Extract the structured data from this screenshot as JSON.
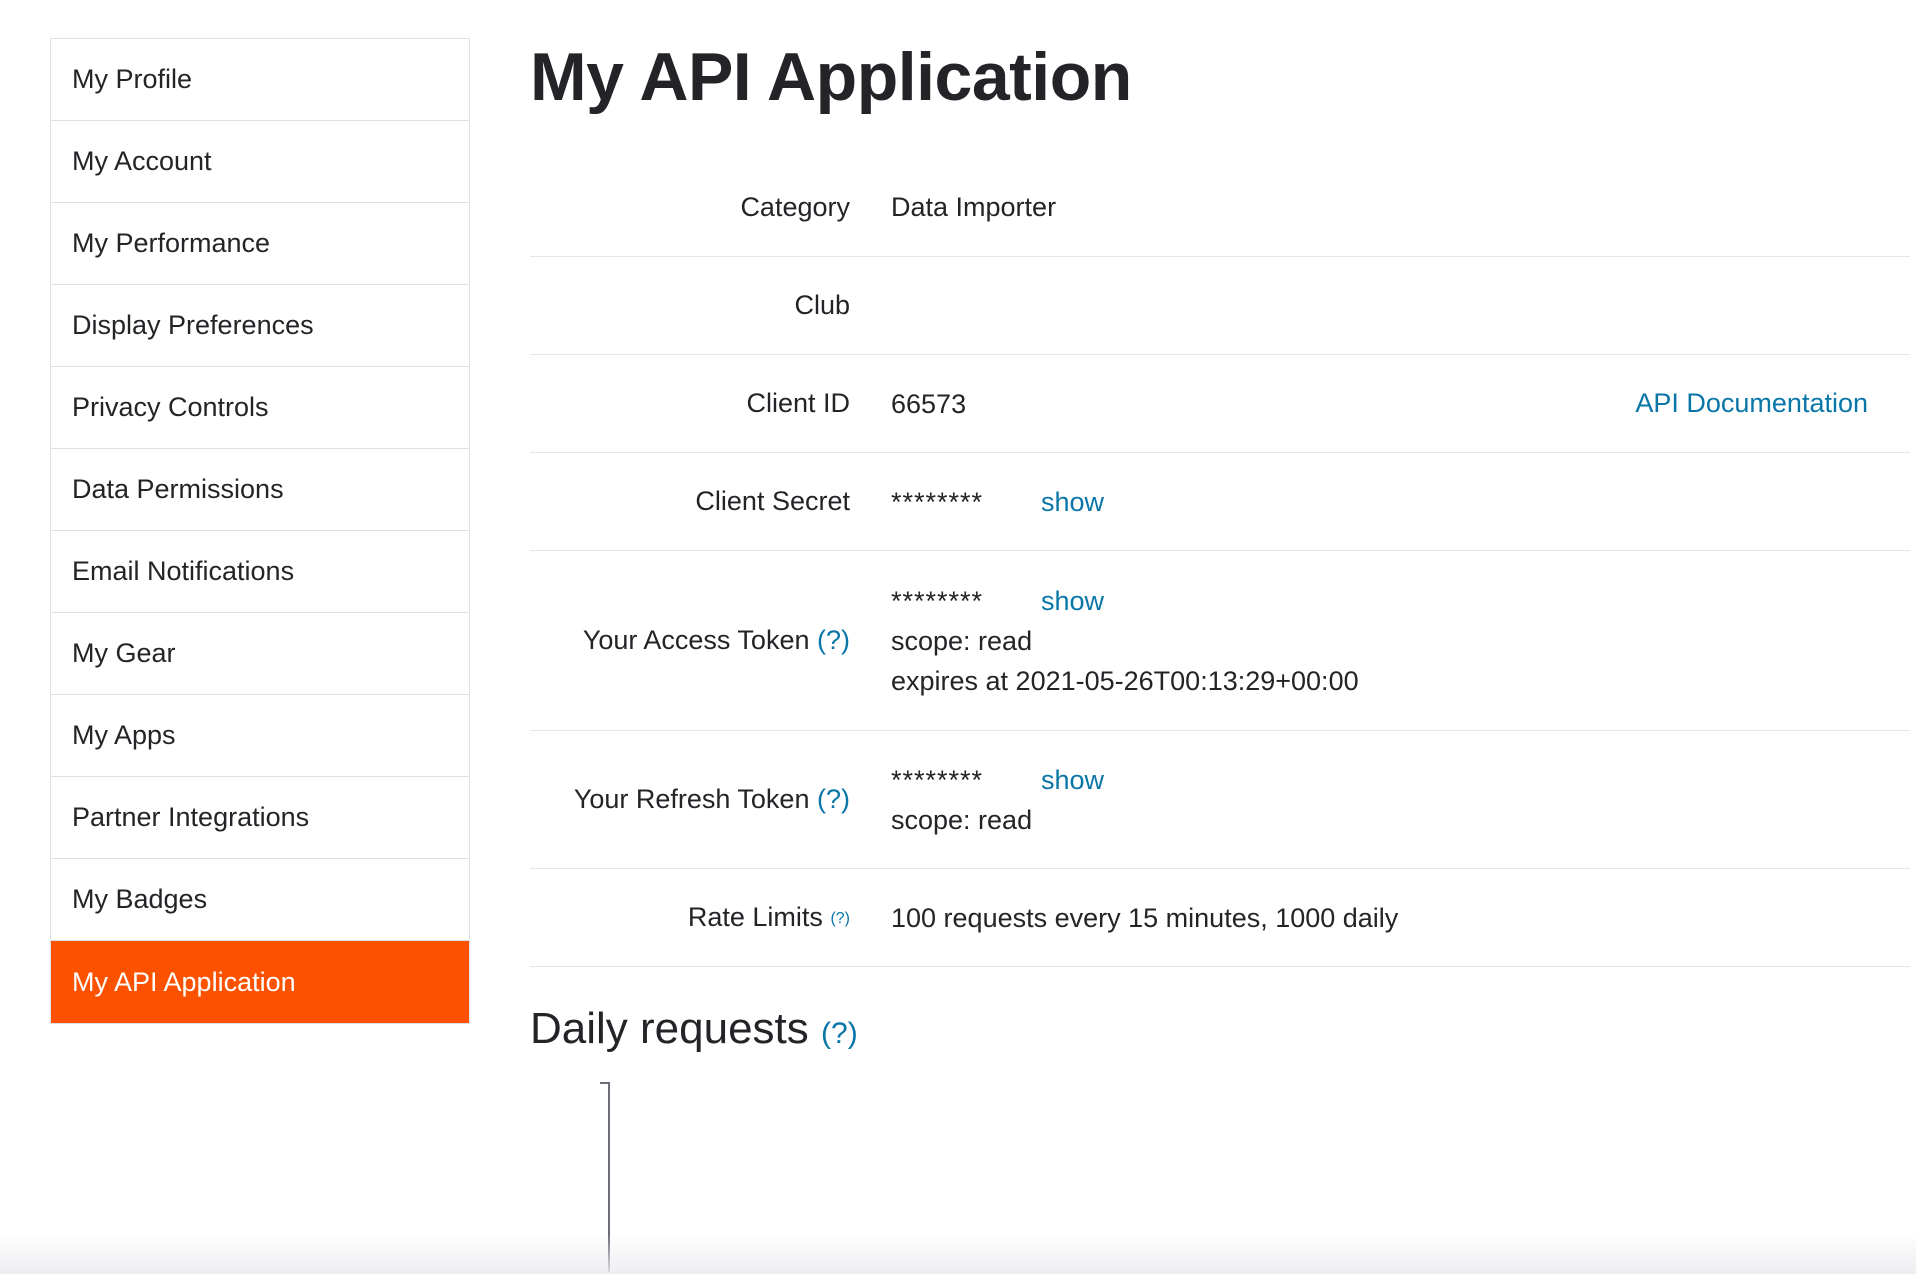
{
  "sidebar": {
    "items": [
      {
        "label": "My Profile"
      },
      {
        "label": "My Account"
      },
      {
        "label": "My Performance"
      },
      {
        "label": "Display Preferences"
      },
      {
        "label": "Privacy Controls"
      },
      {
        "label": "Data Permissions"
      },
      {
        "label": "Email Notifications"
      },
      {
        "label": "My Gear"
      },
      {
        "label": "My Apps"
      },
      {
        "label": "Partner Integrations"
      },
      {
        "label": "My Badges"
      },
      {
        "label": "My API Application",
        "active": true
      }
    ],
    "active_color": "#fc5200"
  },
  "main": {
    "title": "My API Application",
    "rows": {
      "category": {
        "label": "Category",
        "value": "Data Importer"
      },
      "club": {
        "label": "Club",
        "value": ""
      },
      "client_id": {
        "label": "Client ID",
        "value": "66573",
        "link": "API Documentation"
      },
      "client_secret": {
        "label": "Client Secret",
        "value": "********",
        "action": "show"
      },
      "access_token": {
        "label": "Your Access Token",
        "help": "(?)",
        "value": "********",
        "action": "show",
        "scope": "scope: read",
        "expires": "expires at 2021-05-26T00:13:29+00:00"
      },
      "refresh_token": {
        "label": "Your Refresh Token",
        "help": "(?)",
        "value": "********",
        "action": "show",
        "scope": "scope: read"
      },
      "rate_limits": {
        "label": "Rate Limits",
        "help": "(?)",
        "value": "100 requests every 15 minutes, 1000 daily"
      }
    },
    "daily_requests": {
      "title": "Daily requests",
      "help": "(?)"
    }
  },
  "colors": {
    "link": "#0a76a8",
    "text": "#242428",
    "border": "#dfdfe8"
  }
}
